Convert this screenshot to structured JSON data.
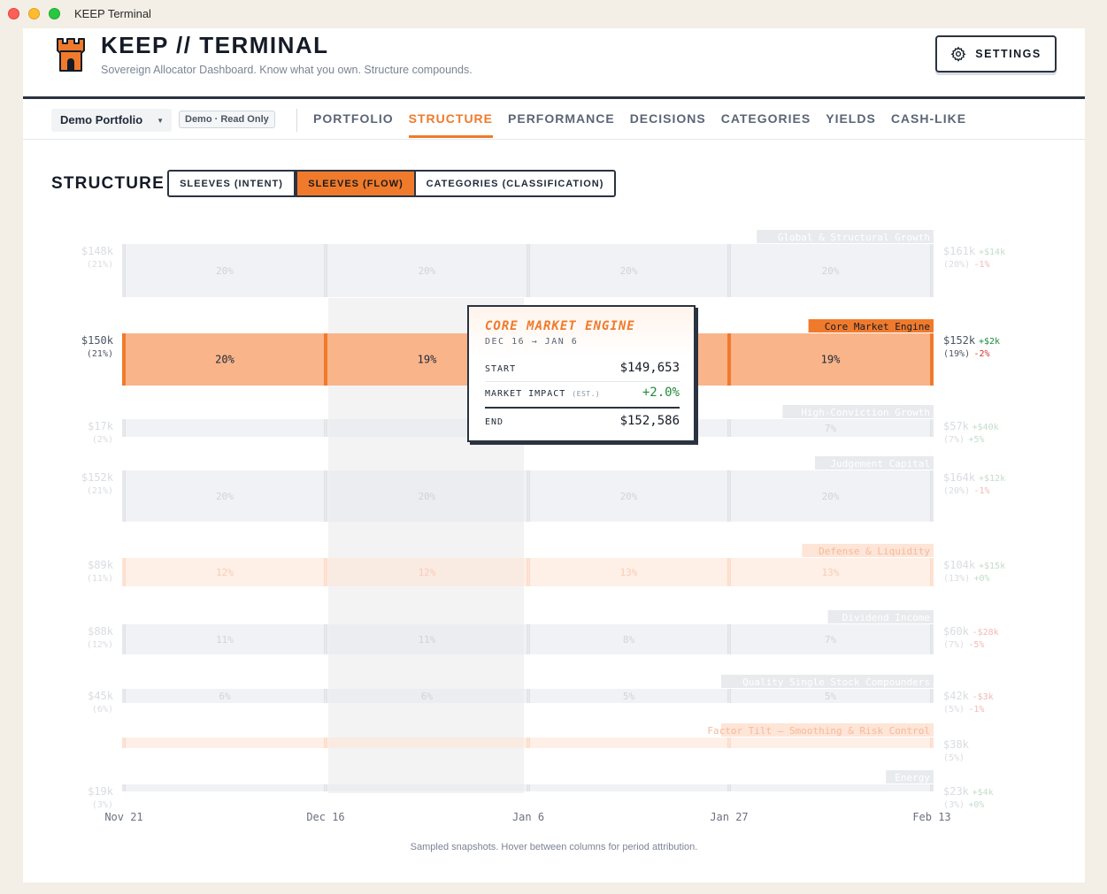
{
  "window": {
    "title": "KEEP Terminal"
  },
  "header": {
    "title": "KEEP // TERMINAL",
    "subtitle": "Sovereign Allocator Dashboard. Know what you own. Structure compounds.",
    "settings_label": "SETTINGS",
    "settings_icon": "gear-icon",
    "logo_icon": "castle-tower-icon"
  },
  "nav": {
    "portfolio": "Demo Portfolio",
    "badge": "Demo · Read Only",
    "tabs": [
      {
        "label": "PORTFOLIO"
      },
      {
        "label": "STRUCTURE"
      },
      {
        "label": "PERFORMANCE"
      },
      {
        "label": "DECISIONS"
      },
      {
        "label": "CATEGORIES"
      },
      {
        "label": "YIELDS"
      },
      {
        "label": "CASH-LIKE"
      }
    ],
    "active_tab": "STRUCTURE"
  },
  "structure": {
    "title": "STRUCTURE",
    "views": [
      "SLEEVES (INTENT)",
      "SLEEVES (FLOW)",
      "CATEGORIES (CLASSIFICATION)"
    ],
    "active_view": "SLEEVES (FLOW)"
  },
  "colors": {
    "accent": "#f07a2c",
    "positive": "#1f8a3a",
    "negative": "#d0342c",
    "ink": "#2b3340"
  },
  "chart_data": {
    "type": "area",
    "dates": [
      "Nov 21",
      "Dec 16",
      "Jan 6",
      "Jan 27",
      "Feb 13"
    ],
    "highlighted_period": [
      "Dec 16",
      "Jan 6"
    ],
    "focused_sleeve": "Core Market Engine",
    "series": [
      {
        "name": "Global & Structural Growth",
        "start": "$148k",
        "start_pct": "(21%)",
        "end": "$161k",
        "end_delta": "+$14k",
        "end_pct": "(20%)",
        "pct_delta": "-1%",
        "shares": [
          "20%",
          "20%",
          "20%",
          "20%"
        ],
        "tint": "gray"
      },
      {
        "name": "Core Market Engine",
        "start": "$150k",
        "start_pct": "(21%)",
        "end": "$152k",
        "end_delta": "+$2k",
        "end_pct": "(19%)",
        "pct_delta": "-2%",
        "shares": [
          "20%",
          "19%",
          "",
          "19%"
        ],
        "tint": "orange"
      },
      {
        "name": "High-Conviction Growth",
        "start": "$17k",
        "start_pct": "(2%)",
        "end": "$57k",
        "end_delta": "+$40k",
        "end_pct": "(7%)",
        "pct_delta": "+5%",
        "shares": [
          "",
          "",
          "",
          "7%"
        ],
        "tint": "gray"
      },
      {
        "name": "Judgement Capital",
        "start": "$152k",
        "start_pct": "(21%)",
        "end": "$164k",
        "end_delta": "+$12k",
        "end_pct": "(20%)",
        "pct_delta": "-1%",
        "shares": [
          "20%",
          "20%",
          "20%",
          "20%"
        ],
        "tint": "gray"
      },
      {
        "name": "Defense & Liquidity",
        "start": "$89k",
        "start_pct": "(11%)",
        "end": "$104k",
        "end_delta": "+$15k",
        "end_pct": "(13%)",
        "pct_delta": "+0%",
        "shares": [
          "12%",
          "12%",
          "13%",
          "13%"
        ],
        "tint": "peach"
      },
      {
        "name": "Dividend Income",
        "start": "$88k",
        "start_pct": "(12%)",
        "end": "$60k",
        "end_delta": "-$28k",
        "end_pct": "(7%)",
        "pct_delta": "-5%",
        "shares": [
          "11%",
          "11%",
          "8%",
          "7%"
        ],
        "tint": "gray"
      },
      {
        "name": "Quality Single Stock Compounders",
        "start": "$45k",
        "start_pct": "(6%)",
        "end": "$42k",
        "end_delta": "-$3k",
        "end_pct": "(5%)",
        "pct_delta": "-1%",
        "shares": [
          "6%",
          "6%",
          "5%",
          "5%"
        ],
        "tint": "gray"
      },
      {
        "name": "Factor Tilt — Smoothing & Risk Control",
        "start": "",
        "start_pct": "",
        "end": "$38k",
        "end_delta": "",
        "end_pct": "(5%)",
        "pct_delta": "",
        "shares": [
          "",
          "",
          "",
          ""
        ],
        "tint": "peach"
      },
      {
        "name": "Energy",
        "start": "$19k",
        "start_pct": "(3%)",
        "end": "$23k",
        "end_delta": "+$4k",
        "end_pct": "(3%)",
        "pct_delta": "+0%",
        "shares": [
          "",
          "",
          "",
          ""
        ],
        "tint": "gray"
      }
    ],
    "footnote": "Sampled snapshots. Hover between columns for period attribution."
  },
  "tooltip": {
    "title": "CORE MARKET ENGINE",
    "range": "DEC 16 → JAN 6",
    "start_label": "START",
    "start_value": "$149,653",
    "impact_label": "MARKET IMPACT",
    "impact_note": "(EST.)",
    "impact_value": "+2.0%",
    "end_label": "END",
    "end_value": "$152,586"
  }
}
